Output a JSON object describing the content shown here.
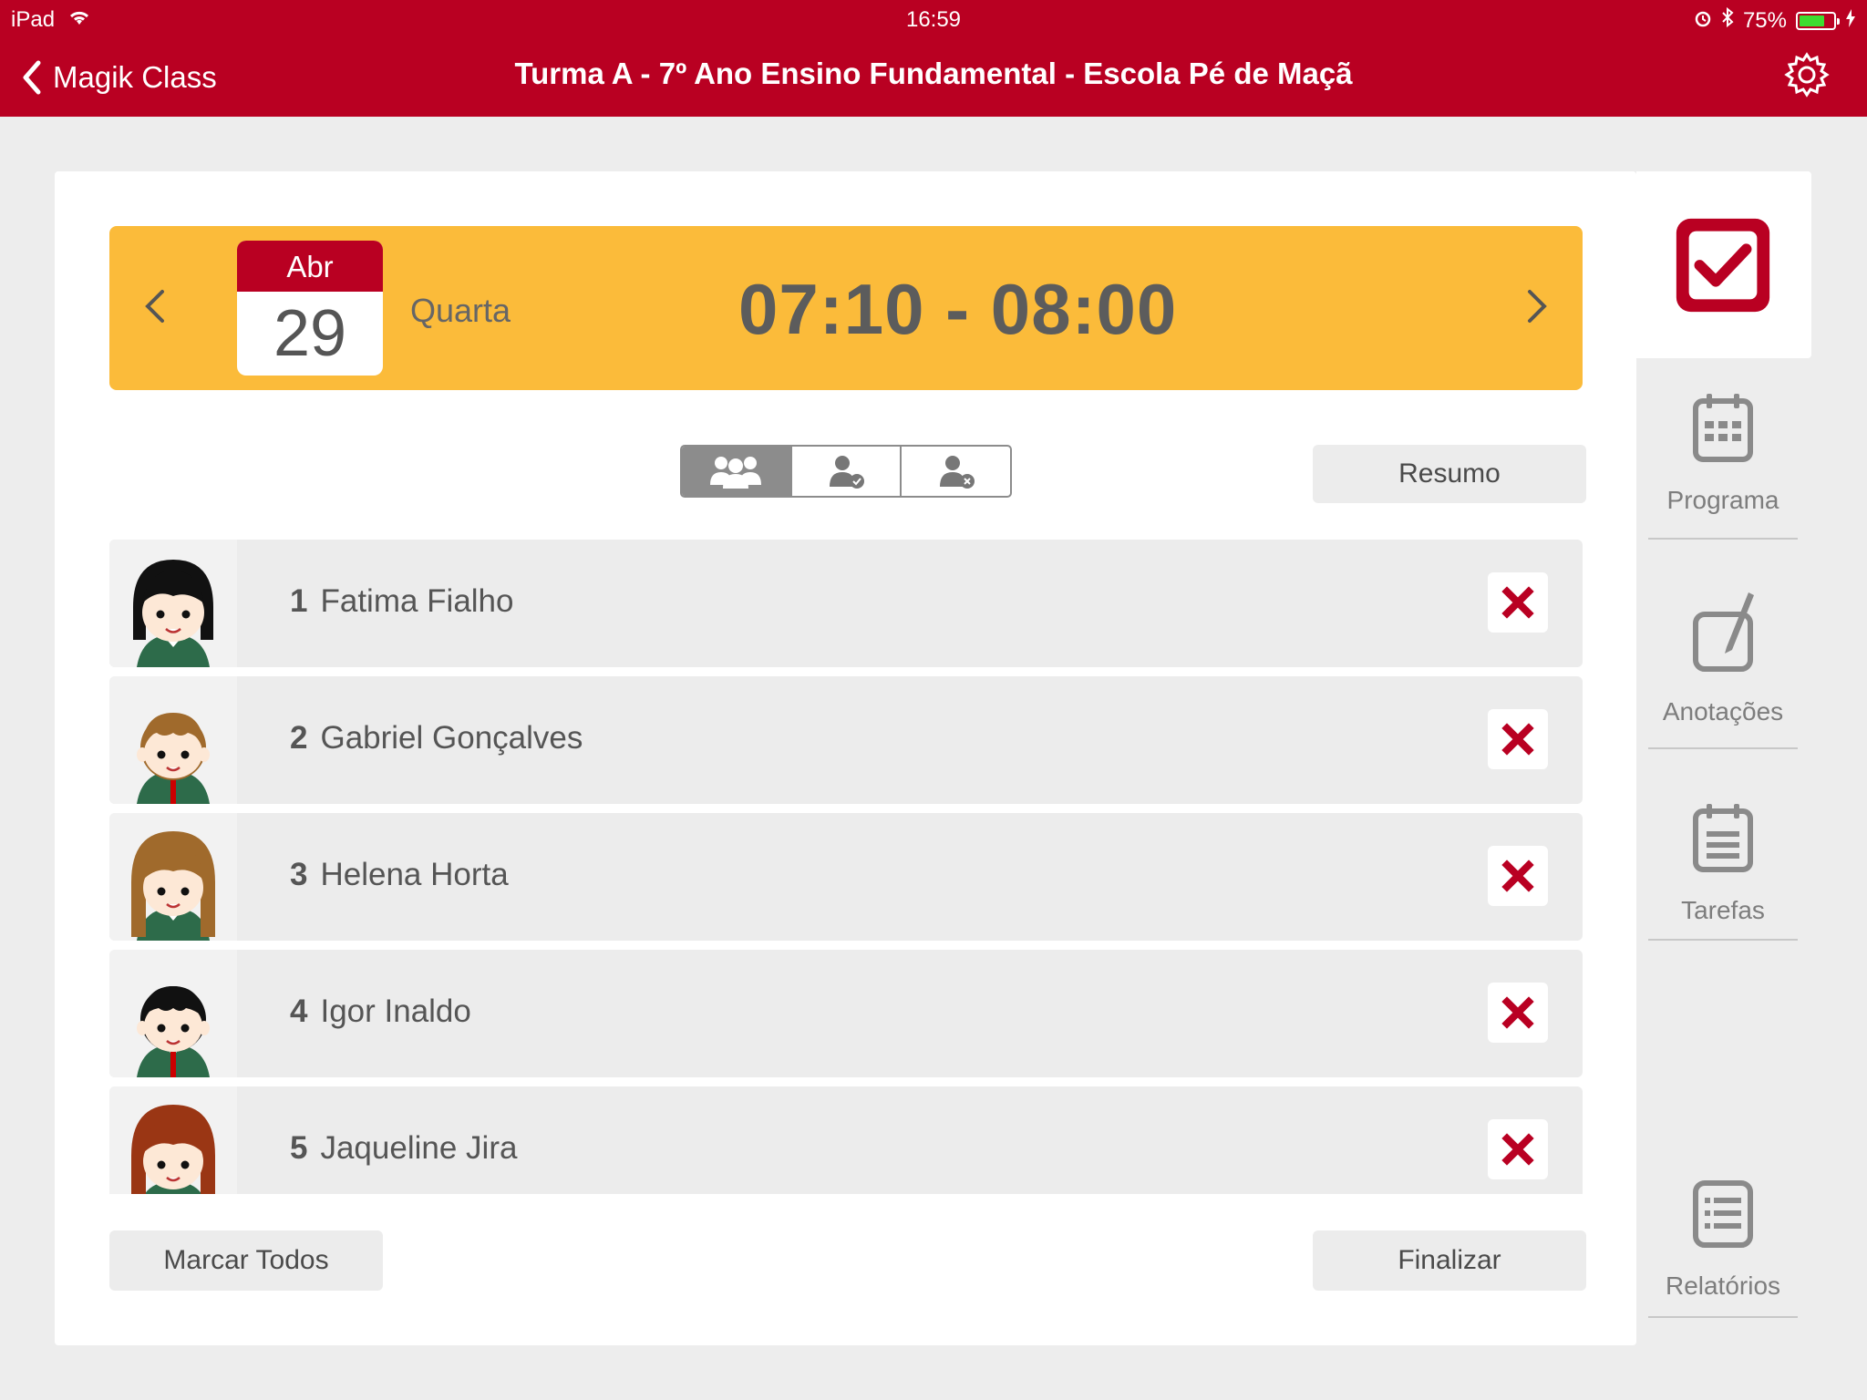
{
  "status_bar": {
    "device": "iPad",
    "time": "16:59",
    "battery": "75%",
    "battery_level": 0.75
  },
  "nav": {
    "back_label": "Magik Class",
    "title": "Turma A - 7º Ano Ensino Fundamental - Escola Pé de Maçã"
  },
  "date_banner": {
    "month": "Abr",
    "day": "29",
    "weekday": "Quarta",
    "time_range": "07:10 - 08:00"
  },
  "filters": {
    "active": "all",
    "options": [
      "all-students-icon",
      "present-student-icon",
      "absent-student-icon"
    ]
  },
  "buttons": {
    "resumo": "Resumo",
    "marcar_todos": "Marcar Todos",
    "finalizar": "Finalizar"
  },
  "students": [
    {
      "num": "1",
      "name": "Fatima Fialho",
      "status": "absent"
    },
    {
      "num": "2",
      "name": "Gabriel Gonçalves",
      "status": "absent"
    },
    {
      "num": "3",
      "name": "Helena Horta",
      "status": "absent"
    },
    {
      "num": "4",
      "name": "Igor Inaldo",
      "status": "absent"
    },
    {
      "num": "5",
      "name": "Jaqueline Jira",
      "status": "absent"
    }
  ],
  "side_tabs": {
    "chamada": "",
    "programa": "Programa",
    "anotacoes": "Anotações",
    "tarefas": "Tarefas",
    "relatorios": "Relatórios"
  },
  "colors": {
    "brand": "#b90022",
    "banner": "#fbbb3a",
    "absent_x": "#b90022"
  }
}
